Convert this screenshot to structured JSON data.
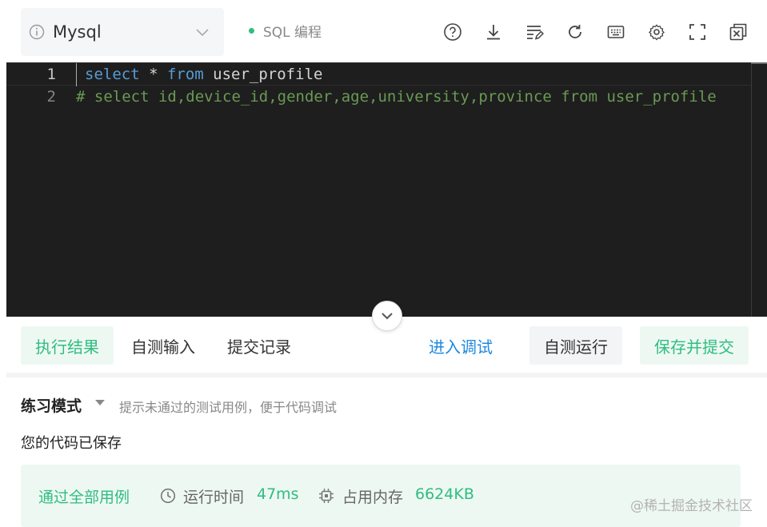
{
  "toolbar": {
    "language": "Mysql",
    "mode": "SQL 编程",
    "icons": [
      "help-icon",
      "download-icon",
      "format-icon",
      "reset-icon",
      "keyboard-icon",
      "settings-icon",
      "fullscreen-icon",
      "popout-icon"
    ]
  },
  "editor": {
    "lines": [
      {
        "number": "1",
        "keyword": "select",
        "rest_a": " * ",
        "keyword2": "from",
        "rest_b": " user_profile"
      },
      {
        "number": "2",
        "comment": "# select id,device_id,gender,age,university,province from user_profile"
      }
    ]
  },
  "actions": {
    "tab_result": "执行结果",
    "tab_input": "自测输入",
    "tab_history": "提交记录",
    "debug": "进入调试",
    "self_run": "自测运行",
    "save_submit": "保存并提交"
  },
  "result": {
    "mode_title": "练习模式",
    "mode_hint": "提示未通过的测试用例，便于代码调试",
    "saved": "您的代码已保存",
    "pass": "通过全部用例",
    "time_label": "运行时间",
    "time_value": "47ms",
    "mem_label": "占用内存",
    "mem_value": "6624KB"
  },
  "watermark": "@稀土掘金技术社区",
  "colors": {
    "accent": "#2fbd80",
    "link": "#1f88e0",
    "editor_bg": "#1e1e1e"
  }
}
